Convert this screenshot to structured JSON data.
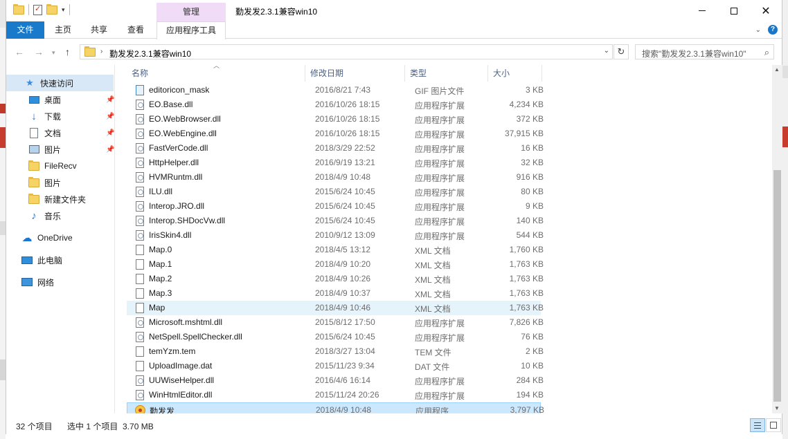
{
  "window": {
    "title": "勤发发2.3.1兼容win10",
    "context_group": "管理"
  },
  "ribbon": {
    "tabs": [
      "文件",
      "主页",
      "共享",
      "查看"
    ],
    "context_tab": "应用程序工具"
  },
  "address": {
    "path": "勤发发2.3.1兼容win10",
    "search_placeholder": "搜索\"勤发发2.3.1兼容win10\""
  },
  "sidebar": {
    "items": [
      {
        "label": "快速访问",
        "icon": "star-icon",
        "pinned": false,
        "selected": true
      },
      {
        "label": "桌面",
        "icon": "desktop-icon",
        "pinned": true
      },
      {
        "label": "下载",
        "icon": "download-icon",
        "pinned": true
      },
      {
        "label": "文档",
        "icon": "document-icon",
        "pinned": true
      },
      {
        "label": "图片",
        "icon": "pictures-icon",
        "pinned": true
      },
      {
        "label": "FileRecv",
        "icon": "folder-icon",
        "pinned": false
      },
      {
        "label": "图片",
        "icon": "folder-icon",
        "pinned": false
      },
      {
        "label": "新建文件夹",
        "icon": "folder-icon",
        "pinned": false
      },
      {
        "label": "音乐",
        "icon": "music-icon",
        "pinned": false
      },
      {
        "label": "OneDrive",
        "icon": "onedrive-icon",
        "pinned": false
      },
      {
        "label": "此电脑",
        "icon": "computer-icon",
        "pinned": false
      },
      {
        "label": "网络",
        "icon": "network-icon",
        "pinned": false
      }
    ]
  },
  "columns": {
    "name": "名称",
    "date": "修改日期",
    "type": "类型",
    "size": "大小"
  },
  "files": [
    {
      "name": "editoricon_mask",
      "date": "2016/8/21 7:43",
      "type": "GIF 图片文件",
      "size": "3 KB",
      "icon": "gif"
    },
    {
      "name": "EO.Base.dll",
      "date": "2016/10/26 18:15",
      "type": "应用程序扩展",
      "size": "4,234 KB",
      "icon": "dll"
    },
    {
      "name": "EO.WebBrowser.dll",
      "date": "2016/10/26 18:15",
      "type": "应用程序扩展",
      "size": "372 KB",
      "icon": "dll"
    },
    {
      "name": "EO.WebEngine.dll",
      "date": "2016/10/26 18:15",
      "type": "应用程序扩展",
      "size": "37,915 KB",
      "icon": "dll"
    },
    {
      "name": "FastVerCode.dll",
      "date": "2018/3/29 22:52",
      "type": "应用程序扩展",
      "size": "16 KB",
      "icon": "dll"
    },
    {
      "name": "HttpHelper.dll",
      "date": "2016/9/19 13:21",
      "type": "应用程序扩展",
      "size": "32 KB",
      "icon": "dll"
    },
    {
      "name": "HVMRuntm.dll",
      "date": "2018/4/9 10:48",
      "type": "应用程序扩展",
      "size": "916 KB",
      "icon": "dll"
    },
    {
      "name": "ILU.dll",
      "date": "2015/6/24 10:45",
      "type": "应用程序扩展",
      "size": "80 KB",
      "icon": "dll"
    },
    {
      "name": "Interop.JRO.dll",
      "date": "2015/6/24 10:45",
      "type": "应用程序扩展",
      "size": "9 KB",
      "icon": "dll"
    },
    {
      "name": "Interop.SHDocVw.dll",
      "date": "2015/6/24 10:45",
      "type": "应用程序扩展",
      "size": "140 KB",
      "icon": "dll"
    },
    {
      "name": "IrisSkin4.dll",
      "date": "2010/9/12 13:09",
      "type": "应用程序扩展",
      "size": "544 KB",
      "icon": "dll"
    },
    {
      "name": "Map.0",
      "date": "2018/4/5 13:12",
      "type": "XML 文档",
      "size": "1,760 KB",
      "icon": "doc"
    },
    {
      "name": "Map.1",
      "date": "2018/4/9 10:20",
      "type": "XML 文档",
      "size": "1,763 KB",
      "icon": "doc"
    },
    {
      "name": "Map.2",
      "date": "2018/4/9 10:26",
      "type": "XML 文档",
      "size": "1,763 KB",
      "icon": "doc"
    },
    {
      "name": "Map.3",
      "date": "2018/4/9 10:37",
      "type": "XML 文档",
      "size": "1,763 KB",
      "icon": "doc"
    },
    {
      "name": "Map",
      "date": "2018/4/9 10:46",
      "type": "XML 文档",
      "size": "1,763 KB",
      "icon": "doc",
      "state": "hover"
    },
    {
      "name": "Microsoft.mshtml.dll",
      "date": "2015/8/12 17:50",
      "type": "应用程序扩展",
      "size": "7,826 KB",
      "icon": "dll"
    },
    {
      "name": "NetSpell.SpellChecker.dll",
      "date": "2015/6/24 10:45",
      "type": "应用程序扩展",
      "size": "76 KB",
      "icon": "dll"
    },
    {
      "name": "temYzm.tem",
      "date": "2018/3/27 13:04",
      "type": "TEM 文件",
      "size": "2 KB",
      "icon": "doc"
    },
    {
      "name": "UploadImage.dat",
      "date": "2015/11/23 9:34",
      "type": "DAT 文件",
      "size": "10 KB",
      "icon": "doc"
    },
    {
      "name": "UUWiseHelper.dll",
      "date": "2016/4/6 16:14",
      "type": "应用程序扩展",
      "size": "284 KB",
      "icon": "dll"
    },
    {
      "name": "WinHtmlEditor.dll",
      "date": "2015/11/24 20:26",
      "type": "应用程序扩展",
      "size": "194 KB",
      "icon": "dll"
    },
    {
      "name": "勤发发",
      "date": "2018/4/9 10:48",
      "type": "应用程序",
      "size": "3,797 KB",
      "icon": "app",
      "state": "selected"
    }
  ],
  "status": {
    "count": "32 个项目",
    "selection": "选中 1 个项目  3.70 MB"
  },
  "colors": {
    "file_tab": "#1979ca",
    "context_tab": "#f0dcf7",
    "selected_row": "#cce8ff",
    "hover_row": "#e5f3fb"
  }
}
